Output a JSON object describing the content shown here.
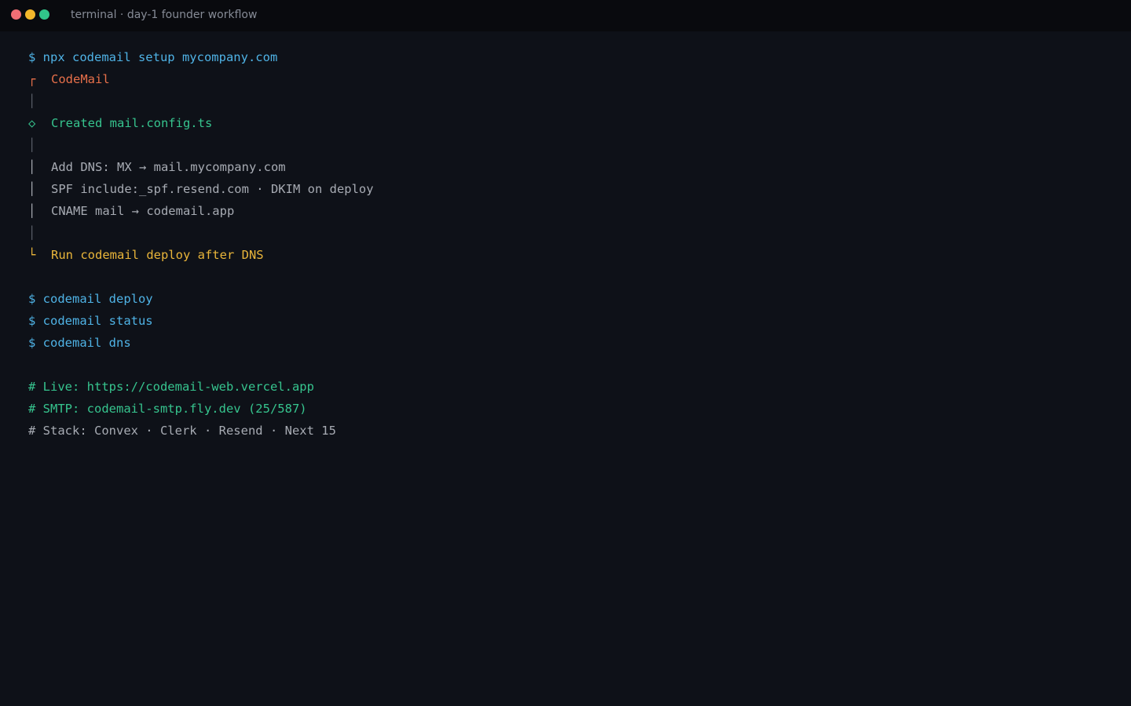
{
  "window": {
    "title": "terminal · day-1 founder workflow"
  },
  "terminal": {
    "setup_command": "$ npx codemail setup mycompany.com",
    "glyphs": {
      "start": "┌",
      "rail": "│",
      "diamond": "◇",
      "end": "└"
    },
    "brand": "CodeMail",
    "created": "Created mail.config.ts",
    "dns_lines": [
      "Add DNS: MX → mail.mycompany.com",
      "SPF include:_spf.resend.com · DKIM on deploy",
      "CNAME mail → codemail.app"
    ],
    "next_step": "Run codemail deploy after DNS",
    "commands": [
      "$ codemail deploy",
      "$ codemail status",
      "$ codemail dns"
    ],
    "comments": [
      "# Live: https://codemail-web.vercel.app",
      "# SMTP: codemail-smtp.fly.dev (25/587)",
      "# Stack: Convex · Clerk · Resend · Next 15"
    ]
  },
  "colors": {
    "background": "#0e1118",
    "command": "#4fb3e6",
    "brand": "#e8704a",
    "success": "#36c48e",
    "warning": "#e9b53a",
    "text": "#a7abb3"
  }
}
